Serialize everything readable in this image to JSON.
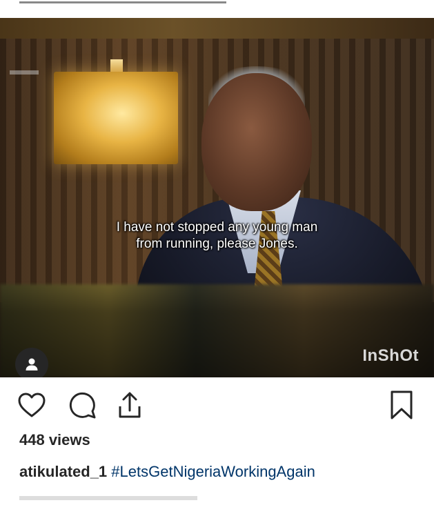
{
  "video": {
    "subtitle_line1": "I have not stopped any young man",
    "subtitle_line2": "from running, please Jones.",
    "watermark": "InShOt"
  },
  "post": {
    "views": "448 views",
    "username": "atikulated_1",
    "hashtag": "#LetsGetNigeriaWorkingAgain"
  },
  "actions": {
    "like_icon": "heart-icon",
    "comment_icon": "comment-bubble-icon",
    "share_icon": "share-upload-icon",
    "save_icon": "bookmark-icon"
  },
  "colors": {
    "text": "#262626",
    "hashtag": "#003569",
    "muted": "#8e8e8e"
  }
}
